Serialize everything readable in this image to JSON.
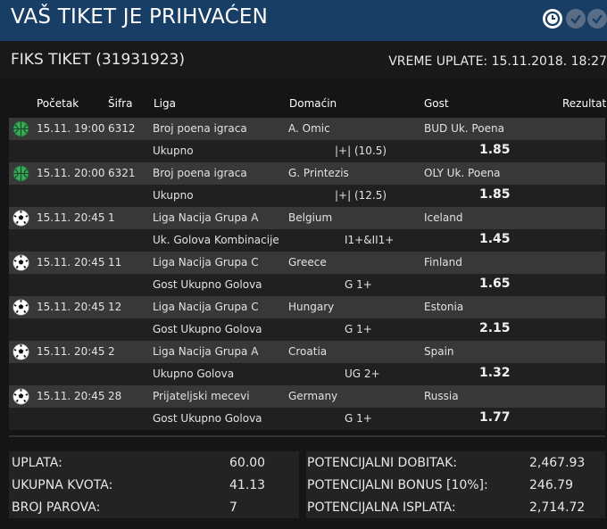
{
  "title": "VAŠ TIKET JE PRIHVAĆEN",
  "icons": {
    "clock": "clock-icon",
    "check": "check-icon",
    "basketball": "basketball-icon",
    "soccer": "soccer-ball-icon"
  },
  "colors": {
    "titlebar": "#183e66",
    "row_main": "#383838",
    "row_sub": "#202020",
    "background": "#151515"
  },
  "ticket": {
    "label": "FIKS TIKET (31931923)",
    "payment_time": "VREME UPLATE: 15.11.2018. 18:27"
  },
  "columns": {
    "start": "Početak",
    "code": "Šifra",
    "league": "Liga",
    "home": "Domaćin",
    "away": "Gost",
    "result": "Rezultat"
  },
  "matches": [
    {
      "sport": "basketball",
      "start": "15.11. 19:00",
      "code": "6312",
      "league": "Broj poena igraca",
      "home": "A. Omic",
      "away": "BUD Uk. Poena",
      "bet": "Ukupno",
      "pick": "|+| (10.5)",
      "odd": "1.85"
    },
    {
      "sport": "basketball",
      "start": "15.11. 20:00",
      "code": "6321",
      "league": "Broj poena igraca",
      "home": "G. Printezis",
      "away": "OLY Uk. Poena",
      "bet": "Ukupno",
      "pick": "|+| (12.5)",
      "odd": "1.85"
    },
    {
      "sport": "soccer",
      "start": "15.11. 20:45",
      "code": "1",
      "league": "Liga Nacija Grupa A",
      "home": "Belgium",
      "away": "Iceland",
      "bet": "Uk. Golova Kombinacije",
      "pick": "I1+&II1+",
      "odd": "1.45"
    },
    {
      "sport": "soccer",
      "start": "15.11. 20:45",
      "code": "11",
      "league": "Liga Nacija Grupa C",
      "home": "Greece",
      "away": "Finland",
      "bet": "Gost Ukupno Golova",
      "pick": "G 1+",
      "odd": "1.65"
    },
    {
      "sport": "soccer",
      "start": "15.11. 20:45",
      "code": "12",
      "league": "Liga Nacija Grupa C",
      "home": "Hungary",
      "away": "Estonia",
      "bet": "Gost Ukupno Golova",
      "pick": "G 1+",
      "odd": "2.15"
    },
    {
      "sport": "soccer",
      "start": "15.11. 20:45",
      "code": "2",
      "league": "Liga Nacija Grupa A",
      "home": "Croatia",
      "away": "Spain",
      "bet": "Ukupno Golova",
      "pick": "UG 2+",
      "odd": "1.32"
    },
    {
      "sport": "soccer",
      "start": "15.11. 20:45",
      "code": "28",
      "league": "Prijateljski mecevi",
      "home": "Germany",
      "away": "Russia",
      "bet": "Gost Ukupno Golova",
      "pick": "G 1+",
      "odd": "1.77"
    }
  ],
  "summary": {
    "left": [
      {
        "label": "UPLATA:",
        "value": "60.00"
      },
      {
        "label": "UKUPNA KVOTA:",
        "value": "41.13"
      },
      {
        "label": "BROJ PAROVA:",
        "value": "7"
      }
    ],
    "right": [
      {
        "label": "POTENCIJALNI DOBITAK:",
        "value": "2,467.93"
      },
      {
        "label": "POTENCIJALNI BONUS [10%]:",
        "value": "246.79"
      },
      {
        "label": "POTENCIJALNA ISPLATA:",
        "value": "2,714.72"
      }
    ]
  }
}
